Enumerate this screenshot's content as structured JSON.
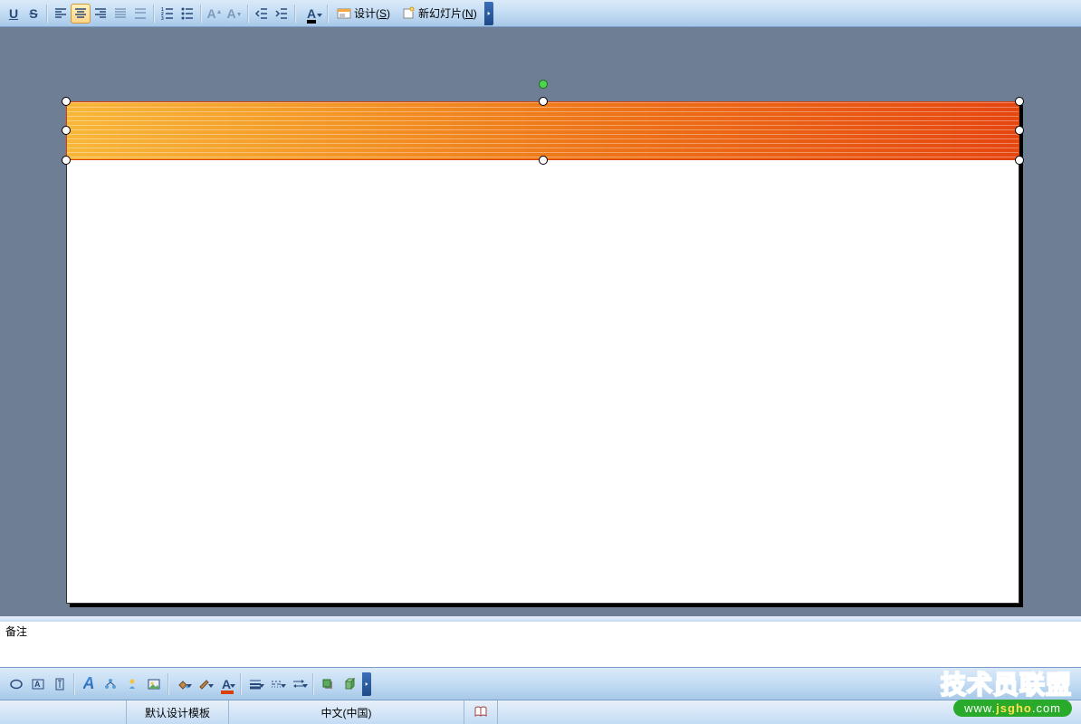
{
  "top_toolbar": {
    "underline": "U",
    "strikethrough": "S",
    "font_grow": "A",
    "font_shrink": "A",
    "font_color_letter": "A",
    "design_label": "设计(S)",
    "design_key": "S",
    "new_slide_label": "新幻灯片(N)",
    "new_slide_key": "N"
  },
  "mini_toolbar": {
    "help_label": "?"
  },
  "notes": {
    "placeholder": "备注"
  },
  "bottom_toolbar": {
    "font_color_letter": "A",
    "wordart_letter": "A"
  },
  "status": {
    "template": "默认设计模板",
    "language": "中文(中国)"
  },
  "watermark": {
    "title": "技术员联盟",
    "url_pre": "www.",
    "url_mid": "jsgho",
    "url_suf": ".com"
  }
}
